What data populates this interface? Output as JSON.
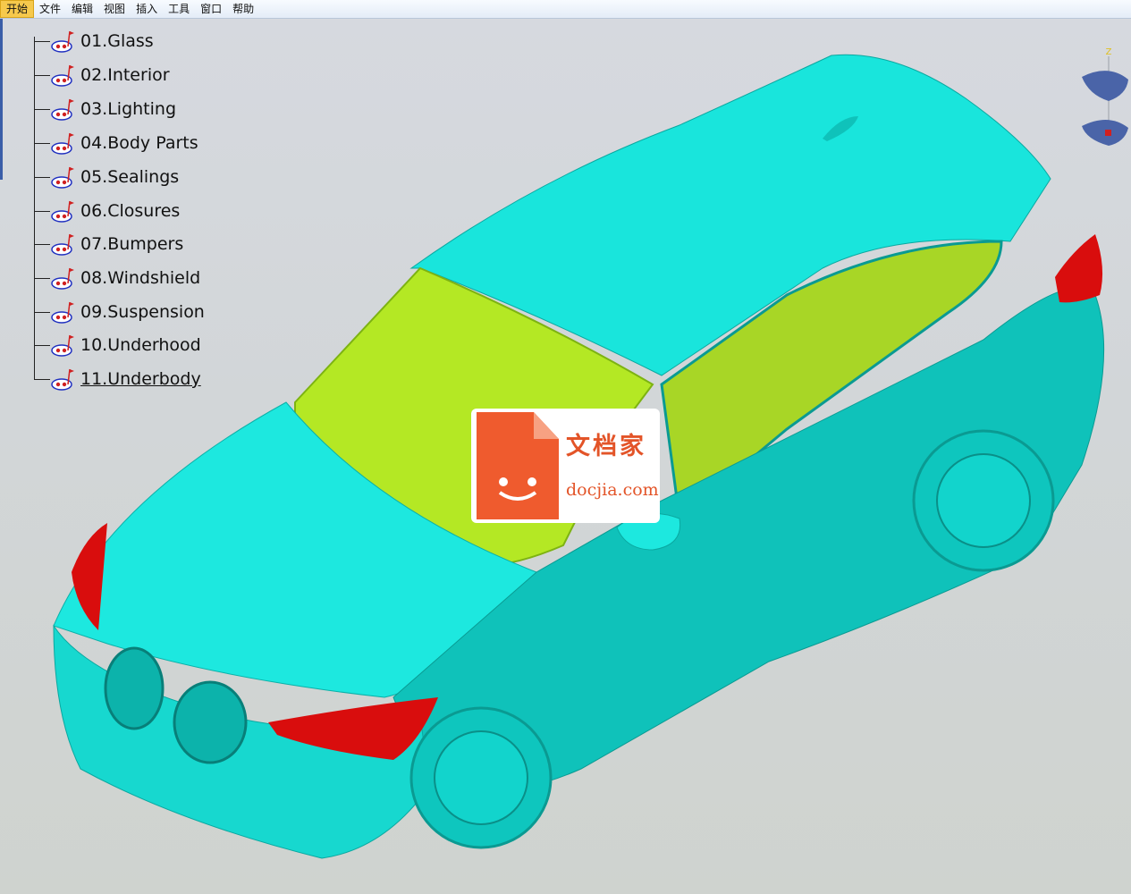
{
  "menu": {
    "items": [
      "开始",
      "文件",
      "编辑",
      "视图",
      "插入",
      "工具",
      "窗口",
      "帮助"
    ]
  },
  "tree": {
    "items": [
      {
        "label": "01.Glass",
        "underlined": false
      },
      {
        "label": "02.Interior",
        "underlined": false
      },
      {
        "label": "03.Lighting",
        "underlined": false
      },
      {
        "label": "04.Body Parts",
        "underlined": false
      },
      {
        "label": "05.Sealings",
        "underlined": false
      },
      {
        "label": "06.Closures",
        "underlined": false
      },
      {
        "label": "07.Bumpers",
        "underlined": false
      },
      {
        "label": "08.Windshield",
        "underlined": false
      },
      {
        "label": "09.Suspension",
        "underlined": false
      },
      {
        "label": "10.Underhood",
        "underlined": false
      },
      {
        "label": "11.Underbody",
        "underlined": true
      }
    ]
  },
  "compass": {
    "axis_label": "Z"
  },
  "watermark": {
    "title": "文档家",
    "site": "docjia.com"
  },
  "colors": {
    "body": "#19e5dc",
    "body_shade": "#0fbdb5",
    "glass": "#a8e61e",
    "lamp": "#d90d0d",
    "accent": "#e35428"
  }
}
